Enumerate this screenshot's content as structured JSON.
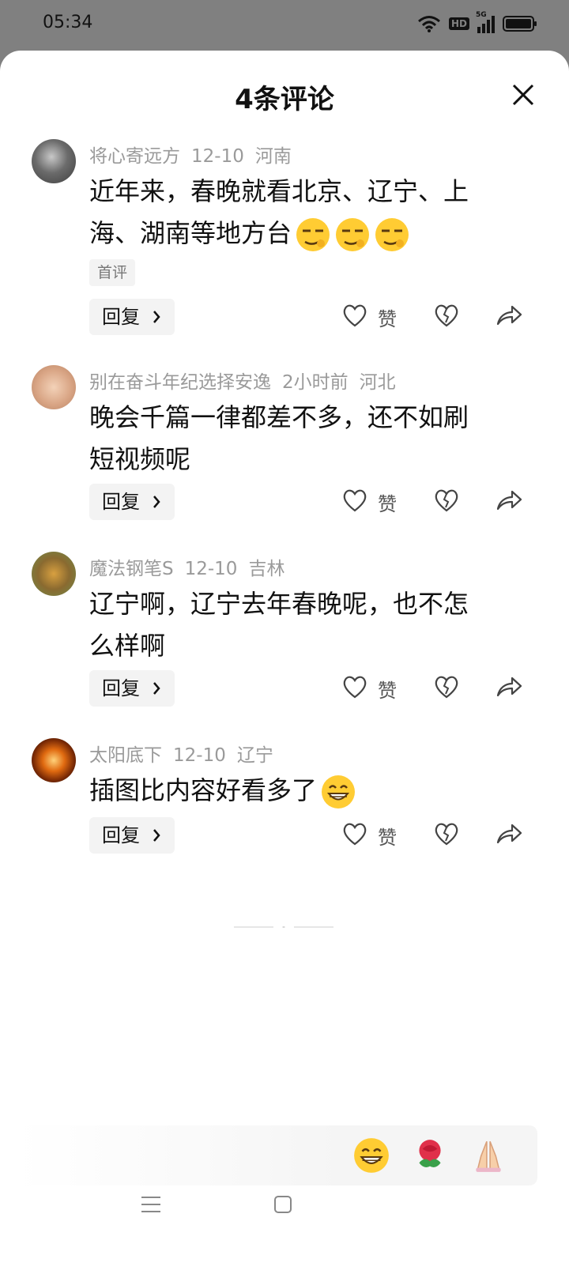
{
  "status": {
    "time": "05:34",
    "hd_label": "HD",
    "network_label": "5G"
  },
  "header": {
    "title": "4条评论"
  },
  "comments": [
    {
      "username": "将心寄远方",
      "date": "12-10",
      "location": "河南",
      "text_line1": "近年来，春晚就看北京、辽宁、上",
      "text_line2": "海、湖南等地方台",
      "emojis": [
        "smirk-glasses-emoji",
        "smirk-glasses-emoji",
        "smirk-glasses-emoji"
      ],
      "tag": "首评",
      "reply_label": "回复",
      "like_label": "赞"
    },
    {
      "username": "别在奋斗年纪选择安逸",
      "date": "2小时前",
      "location": "河北",
      "text_line1": "晚会千篇一律都差不多，还不如刷",
      "text_line2": "短视频呢",
      "reply_label": "回复",
      "like_label": "赞"
    },
    {
      "username": "魔法钢笔S",
      "date": "12-10",
      "location": "吉林",
      "text_line1": "辽宁啊，辽宁去年春晚呢，也不怎",
      "text_line2": "么样啊",
      "reply_label": "回复",
      "like_label": "赞"
    },
    {
      "username": "太阳底下",
      "date": "12-10",
      "location": "辽宁",
      "text_line1": "插图比内容好看多了",
      "emojis": [
        "grin-emoji"
      ],
      "reply_label": "回复",
      "like_label": "赞"
    }
  ],
  "quick_emojis": [
    "grin-emoji",
    "rose-emoji",
    "pray-emoji"
  ],
  "colors": {
    "background_dim": "#808080",
    "sheet": "#ffffff",
    "meta_gray": "#9a9a9a",
    "chip_bg": "#f3f3f3"
  }
}
